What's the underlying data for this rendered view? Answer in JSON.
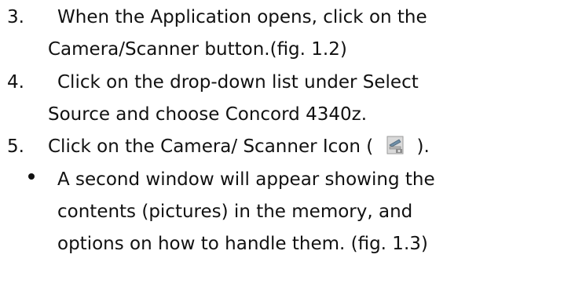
{
  "steps": [
    {
      "number": "3.",
      "lines": [
        "When the Application opens, click on the",
        "Camera/Scanner button.(fig. 1.2)"
      ]
    },
    {
      "number": "4.",
      "lines": [
        "Click on the drop-down list under Select",
        "Source and choose Concord 4340z."
      ]
    },
    {
      "number": "5.",
      "line_before_icon": "Click on the Camera/ Scanner Icon (",
      "line_after_icon": ").",
      "icon": "camera-scanner-icon"
    }
  ],
  "bullet": {
    "lines": [
      "A second window will appear showing the",
      "contents (pictures) in the memory, and",
      "options on how to handle them.   (fig. 1.3)"
    ]
  }
}
